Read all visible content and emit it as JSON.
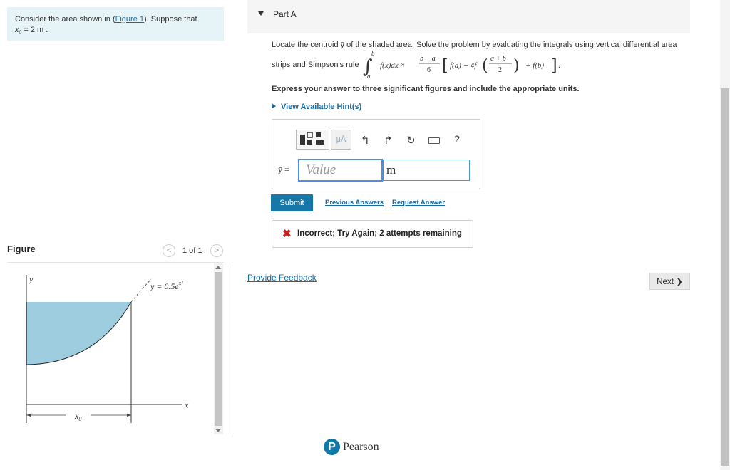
{
  "problem": {
    "prefix": "Consider the area shown in (",
    "figure_link": "Figure 1",
    "suffix": "). Suppose that",
    "x0_symbol": "x",
    "x0_sub": "0",
    "x0_value": " = 2 m ."
  },
  "figure_panel": {
    "title": "Figure",
    "pager": "1 of 1",
    "prev_icon": "chevron-left-icon",
    "next_icon": "chevron-right-icon",
    "equation": "y = 0.5e",
    "equation_exponent": "x²",
    "y_axis": "y",
    "x_axis": "x",
    "x0_label": "x",
    "x0_sub": "0"
  },
  "part": {
    "title": "Part A",
    "instruction_line1": "Locate the centroid ȳ of the shaded area. Solve the problem by evaluating the integrals using vertical differential area",
    "instruction_line2": "strips and Simpson's rule",
    "formula": {
      "upper": "b",
      "lower": "a",
      "integrand": "f(x)dx ≈",
      "frac_num": "b − a",
      "frac_den": "6",
      "fa": "f(a) + 4f",
      "mid_num": "a + b",
      "mid_den": "2",
      "fb": "+ f(b)",
      "end": "."
    },
    "units_note": "Express your answer to three significant figures and include the appropriate units.",
    "hint_link": "View Available Hint(s)"
  },
  "answer": {
    "toolbar": {
      "units_label": "μÅ",
      "help_label": "?"
    },
    "variable_label": "ȳ =",
    "value_placeholder": "Value",
    "units_value": "m",
    "submit_label": "Submit",
    "previous_answers": "Previous Answers",
    "request_answer": "Request Answer"
  },
  "feedback": {
    "icon": "✖",
    "message": "Incorrect; Try Again; 2 attempts remaining"
  },
  "footer": {
    "provide_feedback": "Provide Feedback",
    "next_label": "Next ❯",
    "brand_letter": "P",
    "brand": "Pearson"
  },
  "colors": {
    "accent": "#1677a8",
    "info_bg": "#e6f3f7",
    "shaded_area": "#9fcde0",
    "error": "#cc1f1f"
  }
}
